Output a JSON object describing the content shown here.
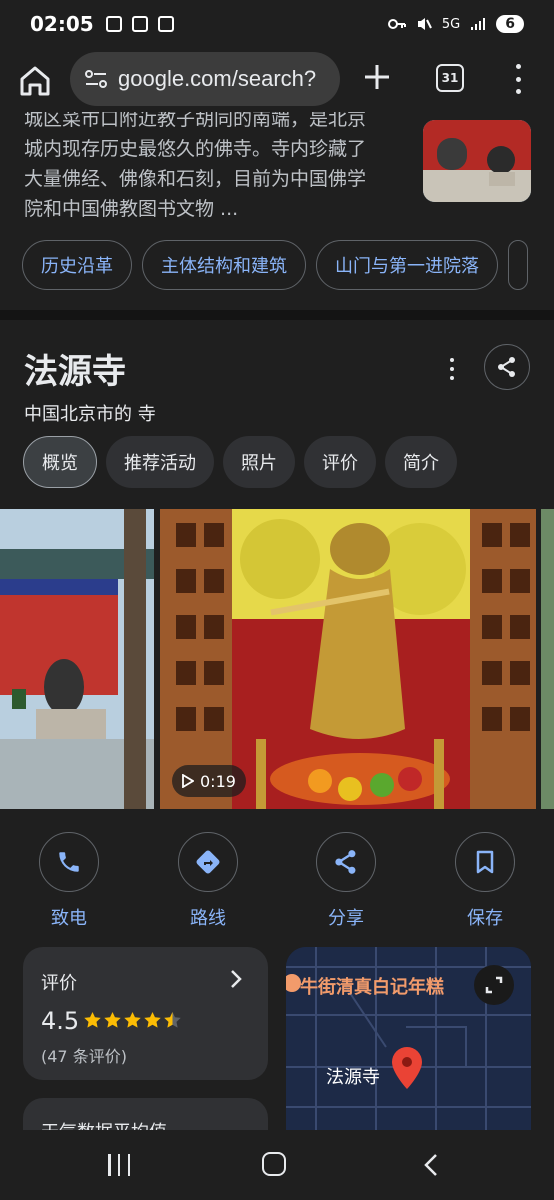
{
  "status_bar": {
    "time": "02:05",
    "network": "5G",
    "battery": "6"
  },
  "toolbar": {
    "url": "google.com/search?",
    "tab_count": "31"
  },
  "snippet": {
    "lines": [
      "城区菜市口附近教子胡同的南端，是北京",
      "城内现存历史最悠久的佛寺。寺内珍藏了",
      "大量佛经、佛像和石刻，目前为中国佛学",
      "院和中国佛教图书文物 ..."
    ]
  },
  "chips": [
    "历史沿革",
    "主体结构和建筑",
    "山门与第一进院落"
  ],
  "knowledge_panel": {
    "title": "法源寺",
    "subtitle": "中国北京市的 寺",
    "tabs": [
      "概览",
      "推荐活动",
      "照片",
      "评价",
      "简介"
    ],
    "active_tab": "概览",
    "video_duration": "0:19"
  },
  "actions": [
    "致电",
    "路线",
    "分享",
    "保存"
  ],
  "rating_card": {
    "label": "评价",
    "score": "4.5",
    "stars": 4.5,
    "count": "(47 条评价)"
  },
  "map_card": {
    "street_label": "牛街清真白记年糕",
    "place_label": "法源寺"
  },
  "weather_card": {
    "title": "天气数据平均值"
  },
  "colors": {
    "background": "#1f1f1f",
    "card": "#303134",
    "link_blue": "#8ab4f8",
    "star_gold": "#fbbc04",
    "map_pin": "#ea4335"
  }
}
